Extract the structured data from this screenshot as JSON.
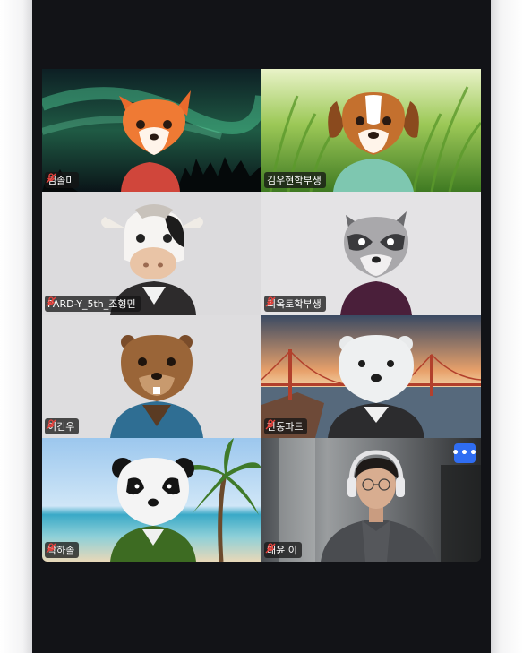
{
  "participants": [
    {
      "name": "김솔미",
      "avatar": "fox-avatar",
      "background": "aurora"
    },
    {
      "name": "김우현학부생",
      "avatar": "dog-avatar",
      "background": "grass",
      "active": true
    },
    {
      "name": "PARD-Y_5th_조형민",
      "avatar": "cow-avatar",
      "background": "plain-gray"
    },
    {
      "name": "최옥토학부생",
      "avatar": "raccoon-avatar",
      "background": "plain-gray"
    },
    {
      "name": "이건우",
      "avatar": "beaver-avatar",
      "background": "plain-gray"
    },
    {
      "name": "한동파드",
      "avatar": "polar-bear-avatar",
      "background": "golden-gate"
    },
    {
      "name": "박하솔",
      "avatar": "panda-avatar",
      "background": "beach"
    },
    {
      "name": "태윤 이",
      "avatar": "camera-video",
      "background": "room"
    }
  ],
  "more_button_label": "•••",
  "colors": {
    "active_border": "#5ad65a",
    "more_button": "#2f6df2",
    "screen_bg": "#121317",
    "mute_icon": "#e8423c"
  }
}
